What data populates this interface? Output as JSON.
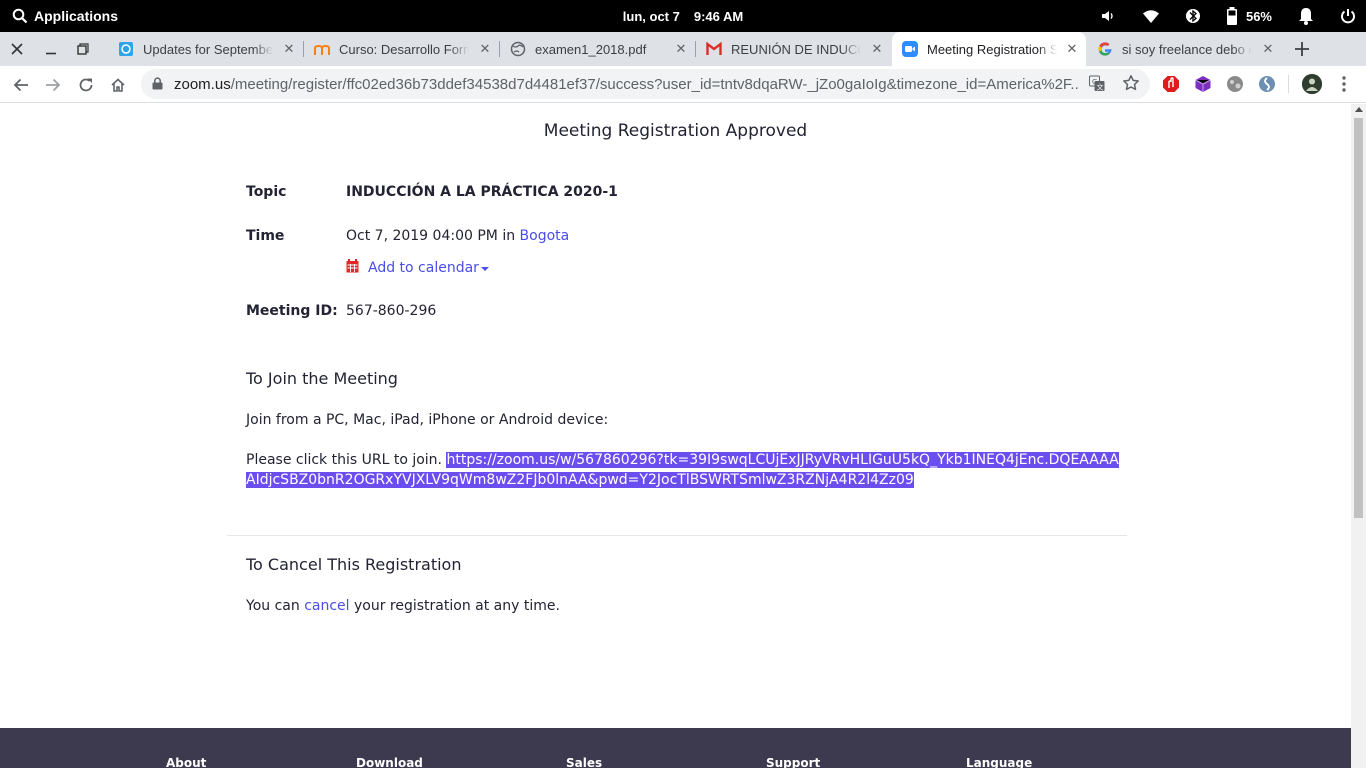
{
  "system_bar": {
    "applications_label": "Applications",
    "date": "lun, oct  7",
    "time": "9:46 AM",
    "battery_percent": "56%"
  },
  "tabs": [
    {
      "title": "Updates for September",
      "favicon": "doc-icon",
      "active": false
    },
    {
      "title": "Curso: Desarrollo Formativo",
      "favicon": "moodle-icon",
      "active": false
    },
    {
      "title": "examen1_2018.pdf",
      "favicon": "globe-icon",
      "active": false
    },
    {
      "title": "REUNIÓN DE INDUCCIÓN",
      "favicon": "gmail-icon",
      "active": false
    },
    {
      "title": "Meeting Registration Success",
      "favicon": "zoom-icon",
      "active": true
    },
    {
      "title": "si soy freelance debo cotizar",
      "favicon": "google-icon",
      "active": false
    }
  ],
  "address_bar": {
    "host": "zoom.us",
    "path": "/meeting/register/ffc02ed36b73ddef34538d7d4481ef37/success?user_id=tntv8dqaRW-_jZo0gaIoIg&timezone_id=America%2F..."
  },
  "page": {
    "title": "Meeting Registration Approved",
    "topic_label": "Topic",
    "topic_value": "INDUCCIÓN A LA PRÁCTICA 2020-1",
    "time_label": "Time",
    "time_value": "Oct 7, 2019 04:00 PM",
    "time_in": "in",
    "timezone": "Bogota",
    "add_to_calendar": "Add to calendar",
    "meeting_id_label": "Meeting ID:",
    "meeting_id_value": "567-860-296",
    "join_heading": "To Join the Meeting",
    "join_devices": "Join from a PC, Mac, iPad, iPhone or Android device:",
    "join_prompt": "Please click this URL to join.",
    "join_url": "https://zoom.us/w/567860296?tk=39I9swqLCUjExJJRyVRvHLIGuU5kQ_Ykb1INEQ4jEnc.DQEAAAAAIdjcSBZ0bnR2OGRxYVJXLV9qWm8wZ2FJb0lnAA&pwd=Y2JocTlBSWRTSmlwZ3RZNjA4R2l4Zz09",
    "cancel_heading": "To Cancel This Registration",
    "cancel_pre": "You can",
    "cancel_link": "cancel",
    "cancel_post": "your registration at any time."
  },
  "footer": {
    "about": "About",
    "download": "Download",
    "sales": "Sales",
    "support": "Support",
    "language": "Language"
  },
  "colors": {
    "link": "#4a4de8",
    "selection": "#6b4ef0",
    "footer_bg": "#3d3a4f",
    "zoom_blue": "#2d8cff",
    "calendar_red": "#e02828"
  }
}
